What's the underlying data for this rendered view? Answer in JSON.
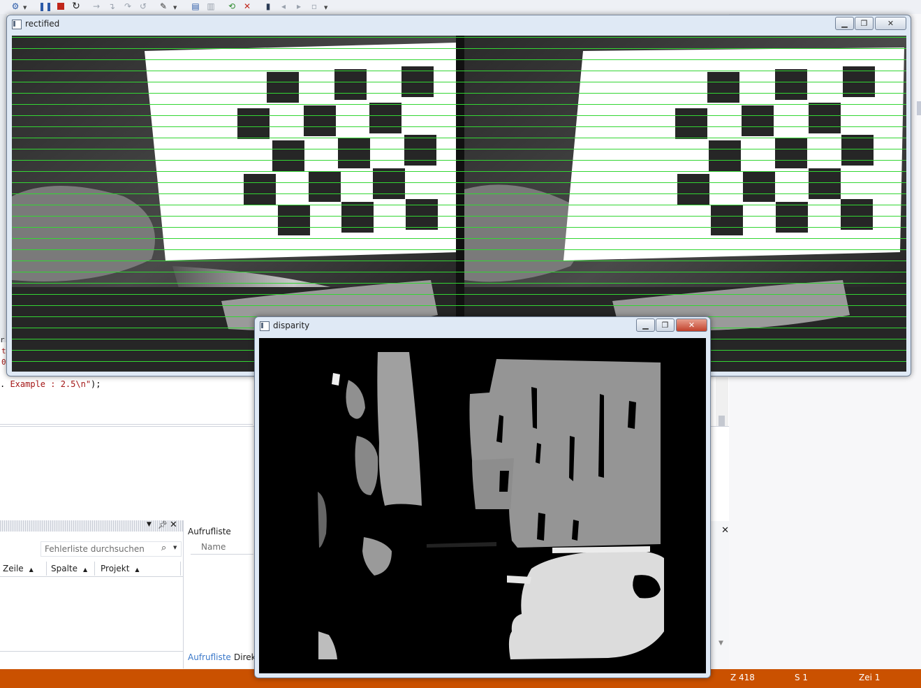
{
  "ide": {
    "code_fragment_prefix": ". ",
    "code_fragment_string": "Example : 2.5\\n\"",
    "code_fragment_suffix": ");",
    "left_fragments": [
      "r[",
      "t",
      "0",
      "."
    ],
    "errorlist": {
      "search_placeholder": "Fehlerliste durchsuchen",
      "columns": [
        {
          "label": "Zeile"
        },
        {
          "label": "Spalte"
        },
        {
          "label": "Projekt"
        }
      ]
    },
    "callstack": {
      "title": "Aufrufliste",
      "column_name": "Name",
      "tabs": [
        "Aufrufliste",
        "Direk"
      ]
    },
    "statusbar": {
      "line": "Z 418",
      "col": "S 1",
      "char": "Zei 1"
    },
    "colors": {
      "statusbar": "#ca5100",
      "accent": "#3a78c9"
    }
  },
  "windows": {
    "rectified": {
      "title": "rectified",
      "epipolar_line_color": "#33d633"
    },
    "disparity": {
      "title": "disparity"
    }
  },
  "icons": {
    "toolbar": [
      "debug-icon",
      "pause-icon",
      "stop-icon",
      "restart-icon",
      "step-next-icon",
      "step-into-icon",
      "step-over-icon",
      "step-out-icon",
      "hex-icon",
      "threads-icon",
      "stack-icon",
      "breakpoint-icon",
      "bookmark-icon"
    ]
  }
}
